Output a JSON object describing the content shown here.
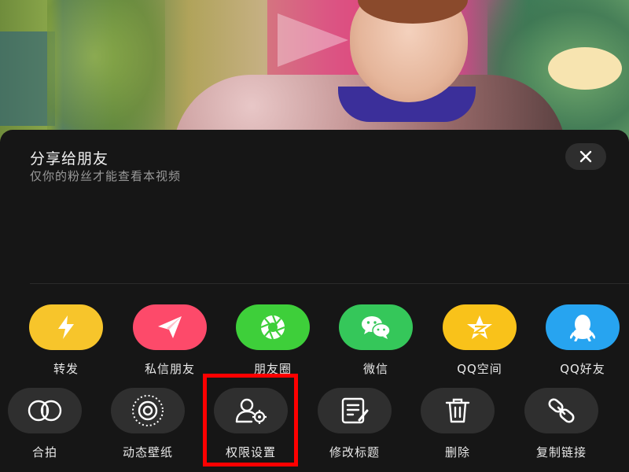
{
  "video": {
    "play_icon": "play-icon"
  },
  "sheet": {
    "title": "分享给朋友",
    "subtitle": "仅你的粉丝才能查看本视频",
    "close_icon": "close-icon"
  },
  "share_row": [
    {
      "label": "转发",
      "icon": "lightning-icon",
      "color": "#f7c52b"
    },
    {
      "label": "私信朋友",
      "icon": "paper-plane-icon",
      "color": "#fd4a6a"
    },
    {
      "label": "朋友圈",
      "icon": "moments-aperture-icon",
      "color": "#3ecf3a"
    },
    {
      "label": "微信",
      "icon": "wechat-icon",
      "color": "#35c75a"
    },
    {
      "label": "QQ空间",
      "icon": "qzone-star-icon",
      "color": "#f9c21a"
    },
    {
      "label": "QQ好友",
      "icon": "qq-penguin-icon",
      "color": "#27a4f0"
    }
  ],
  "action_row": [
    {
      "label": "合拍",
      "icon": "duet-icon"
    },
    {
      "label": "动态壁纸",
      "icon": "live-wallpaper-icon"
    },
    {
      "label": "权限设置",
      "icon": "permission-settings-icon"
    },
    {
      "label": "修改标题",
      "icon": "edit-title-icon"
    },
    {
      "label": "删除",
      "icon": "trash-icon"
    },
    {
      "label": "复制链接",
      "icon": "link-icon"
    }
  ],
  "colors": {
    "sheet_bg": "#161616",
    "action_circle": "#2f2f2f",
    "highlight": "#ff0000"
  }
}
